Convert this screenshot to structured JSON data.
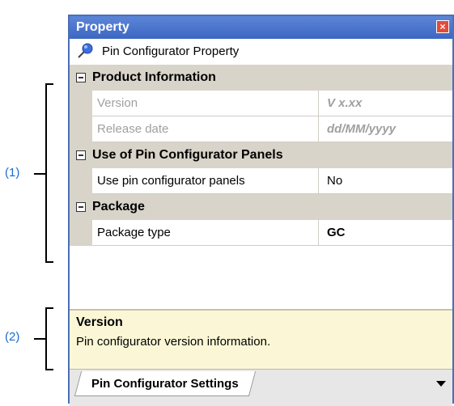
{
  "callouts": {
    "c1": "(1)",
    "c2": "(2)"
  },
  "panel": {
    "title": "Property",
    "close_glyph": "×",
    "object_label": "Pin Configurator Property",
    "object_icon": "pin-icon"
  },
  "grid": {
    "categories": [
      {
        "label": "Product Information",
        "props": [
          {
            "name": "Version",
            "value": "V x.xx",
            "disabled": true
          },
          {
            "name": "Release date",
            "value": "dd/MM/yyyy",
            "disabled": true
          }
        ]
      },
      {
        "label": "Use of Pin Configurator Panels",
        "props": [
          {
            "name": "Use pin configurator panels",
            "value": "No",
            "disabled": false
          }
        ]
      },
      {
        "label": "Package",
        "props": [
          {
            "name": "Package type",
            "value": "GC",
            "disabled": false
          }
        ]
      }
    ]
  },
  "description": {
    "title": "Version",
    "text": "Pin configurator version information."
  },
  "tabs": {
    "active": "Pin Configurator Settings"
  },
  "colors": {
    "title_bar": "#3c67c2",
    "category_bg": "#d8d4c9",
    "description_bg": "#fbf7d6",
    "callout": "#1a6bd0"
  }
}
